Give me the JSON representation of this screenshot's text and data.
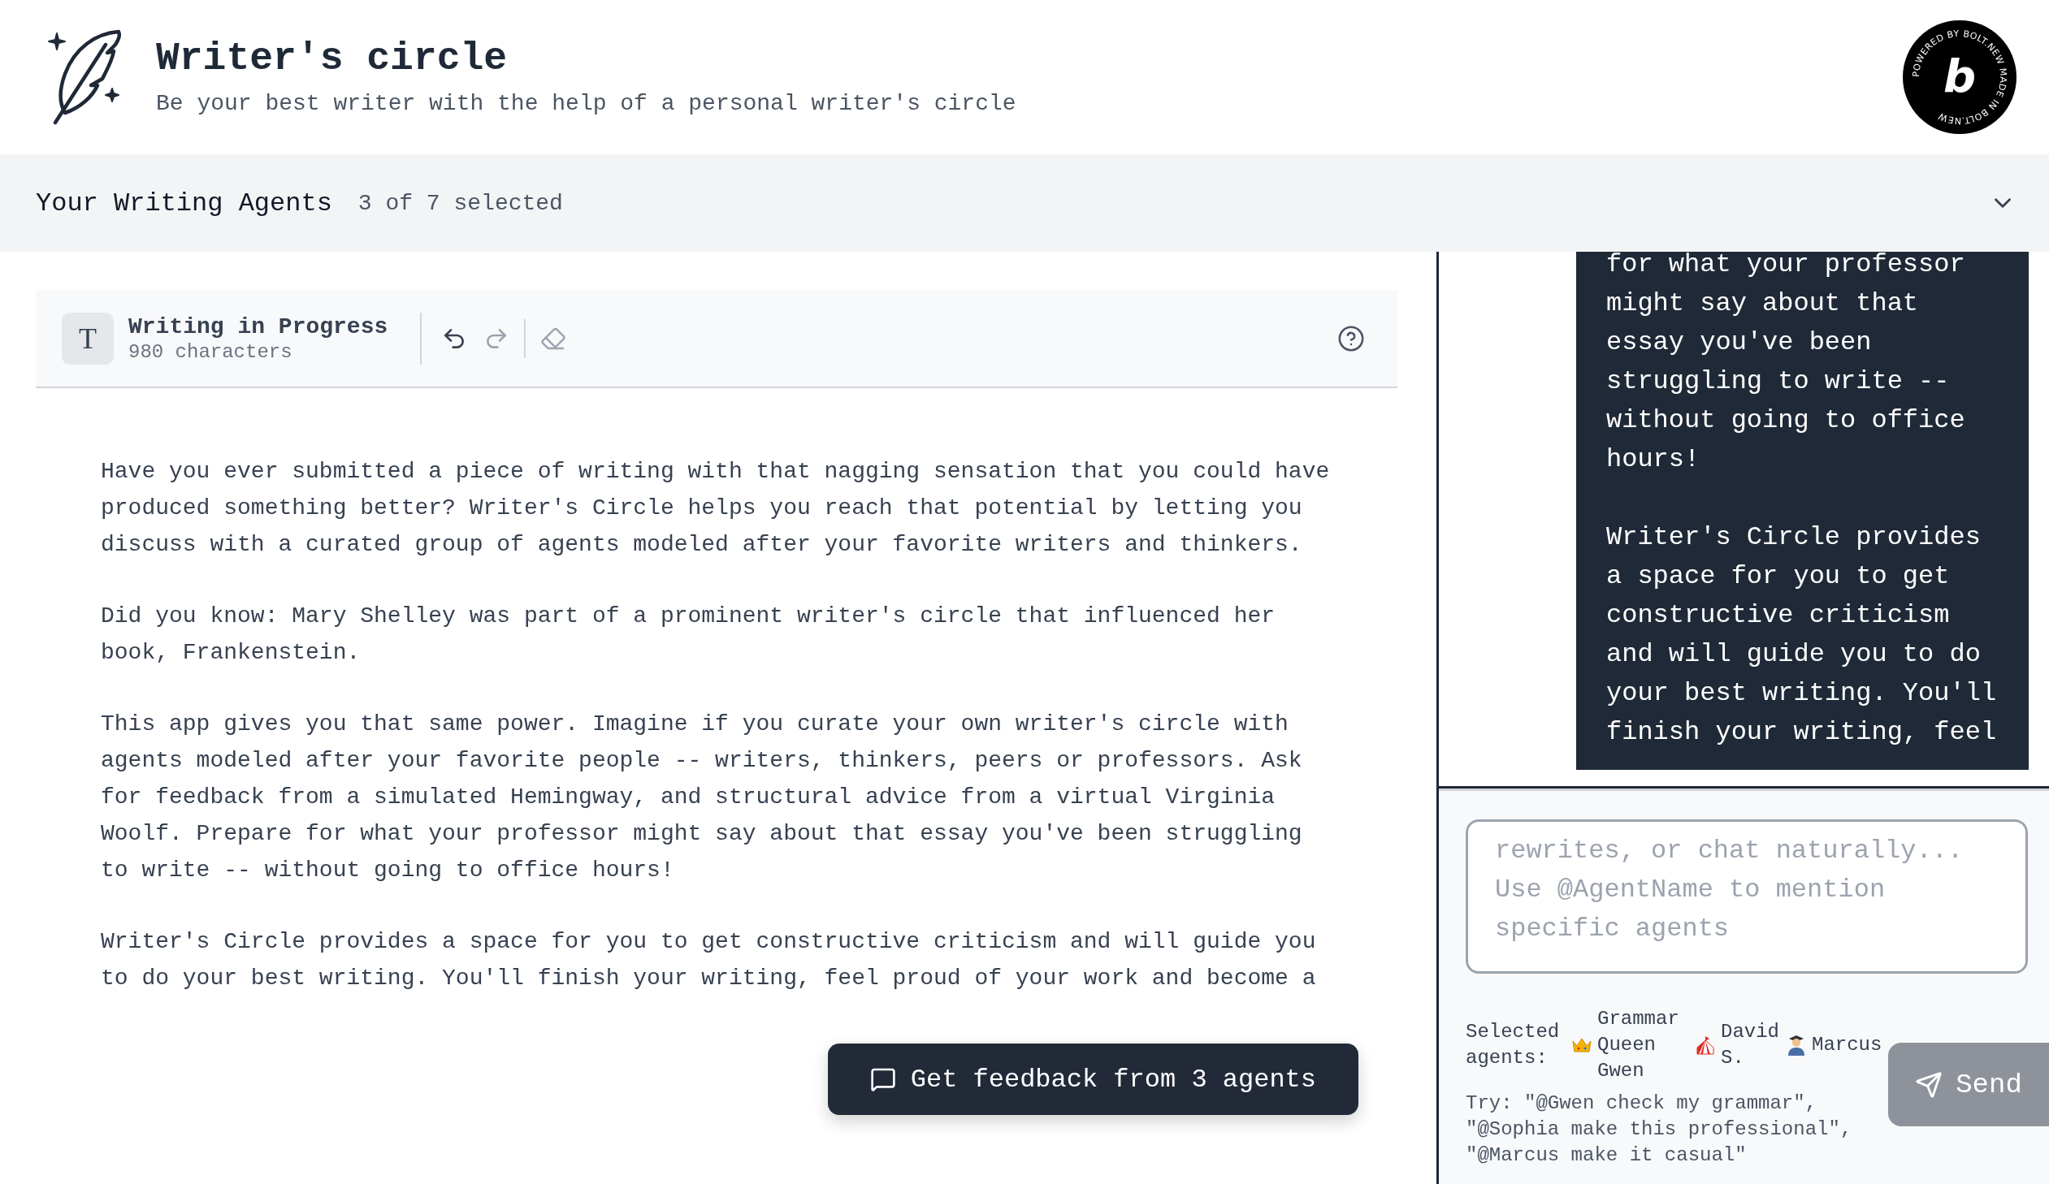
{
  "app": {
    "title": "Writer's circle",
    "subtitle": "Be your best writer with the help of a personal writer's circle"
  },
  "badge": {
    "ring_text": "POWERED BY BOLT.NEW MADE IN BOLT.NEW",
    "letter": "b"
  },
  "agents_bar": {
    "title": "Your Writing Agents",
    "count": "3 of 7 selected",
    "expanded": false
  },
  "editor": {
    "icon_letter": "T",
    "title": "Writing in Progress",
    "char_count": "980 characters",
    "undo_disabled": false,
    "redo_disabled": true,
    "paragraphs": [
      "Have you ever submitted a piece of writing with that nagging sensation that you could have produced something better? Writer's Circle helps you reach that potential by letting you discuss with a curated group of agents modeled after your favorite writers and thinkers.",
      "Did you know: Mary Shelley was part of a prominent writer's circle that influenced her book, Frankenstein.",
      "This app gives you that same power. Imagine if you curate your own writer's circle with agents modeled after your favorite people -- writers, thinkers, peers or professors. Ask for feedback from a simulated Hemingway, and structural advice from a virtual Virginia Woolf. Prepare for what your professor might say about that essay you've been struggling to write -- without going to office hours!",
      "Writer's Circle provides a space for you to get constructive criticism and will guide you to do your best writing. You'll finish your writing, feel proud of your work and become a"
    ]
  },
  "feedback_button": {
    "label": "Get feedback from 3 agents"
  },
  "chat": {
    "messages": [
      {
        "kind": "sent",
        "paragraphs": [
          "for what your professor might say about that essay you've been struggling to write -- without going to office hours!",
          "Writer's Circle provides a space for you to get constructive criticism and will guide you to do your best writing. You'll finish your writing, feel"
        ]
      }
    ],
    "input": {
      "placeholder": "rewrites, or chat naturally... Use @AgentName to mention specific agents"
    },
    "selected_label": "Selected agents:",
    "selected_agents": [
      {
        "kind": "crown",
        "name": "Grammar Queen Gwen"
      },
      {
        "kind": "tent",
        "name": "David S."
      },
      {
        "kind": "student",
        "name": "Marcus"
      }
    ],
    "hint": "Try: \"@Gwen check my grammar\", \"@Sophia make this professional\", \"@Marcus make it casual\"",
    "send": {
      "label": "Send",
      "disabled": true
    }
  }
}
